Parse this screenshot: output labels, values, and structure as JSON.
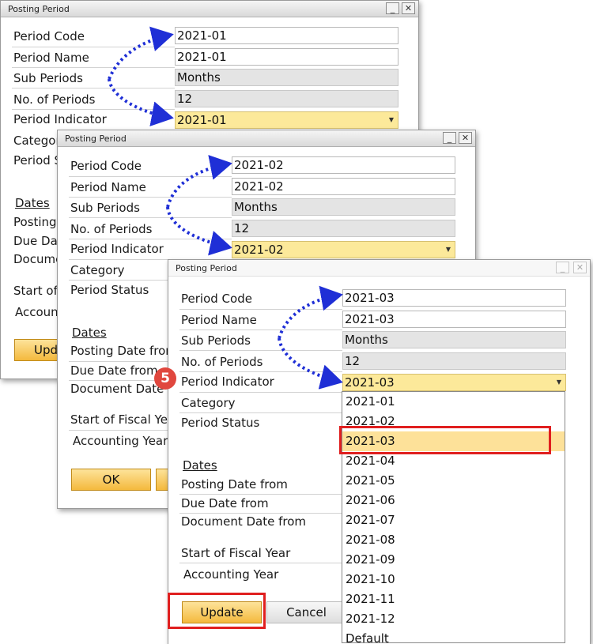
{
  "window_title": "Posting Period",
  "title_buttons": {
    "minimize": "_",
    "close": "✕"
  },
  "labels": {
    "period_code": "Period Code",
    "period_name": "Period Name",
    "sub_periods": "Sub Periods",
    "no_of_periods": "No. of Periods",
    "period_indicator": "Period Indicator",
    "category": "Category",
    "period_status": "Period Status",
    "dates": "Dates",
    "posting_date_from": "Posting Date from",
    "due_date_from": "Due Date from",
    "document_date_from": "Document Date from",
    "start_of_fiscal_year": "Start of Fiscal Year",
    "accounting_year": "Accounting Year"
  },
  "win1": {
    "period_code": "2021-01",
    "period_name": "2021-01",
    "sub_periods": "Months",
    "no_of_periods": "12",
    "period_indicator": "2021-01",
    "clipped": {
      "category": "Categor",
      "period_status": "Period S",
      "posting": "Posting",
      "due": "Due Dat",
      "document": "Docume",
      "start": "Start of",
      "accounting": "Accoun",
      "update": "Upd"
    }
  },
  "win2": {
    "period_code": "2021-02",
    "period_name": "2021-02",
    "sub_periods": "Months",
    "no_of_periods": "12",
    "period_indicator": "2021-02",
    "clipped": {
      "posting": "Posting Date fron",
      "due": "Due Date from",
      "document": "Document Date",
      "start": "Start of Fiscal Yea",
      "accounting": "Accounting Year"
    },
    "ok_label": "OK"
  },
  "win3": {
    "period_code": "2021-03",
    "period_name": "2021-03",
    "sub_periods": "Months",
    "no_of_periods": "12",
    "period_indicator": "2021-03",
    "update_label": "Update",
    "cancel_label": "Cancel"
  },
  "dropdown_options": [
    "2021-01",
    "2021-02",
    "2021-03",
    "2021-04",
    "2021-05",
    "2021-06",
    "2021-07",
    "2021-08",
    "2021-09",
    "2021-10",
    "2021-11",
    "2021-12",
    "Default"
  ],
  "dropdown_selected_index": 2,
  "step_badge": "5",
  "colors": {
    "arrow": "#1f2fd6",
    "highlight_box": "#e01f1f",
    "field_selected": "#fce99a",
    "button_primary": "#f4b93d"
  }
}
